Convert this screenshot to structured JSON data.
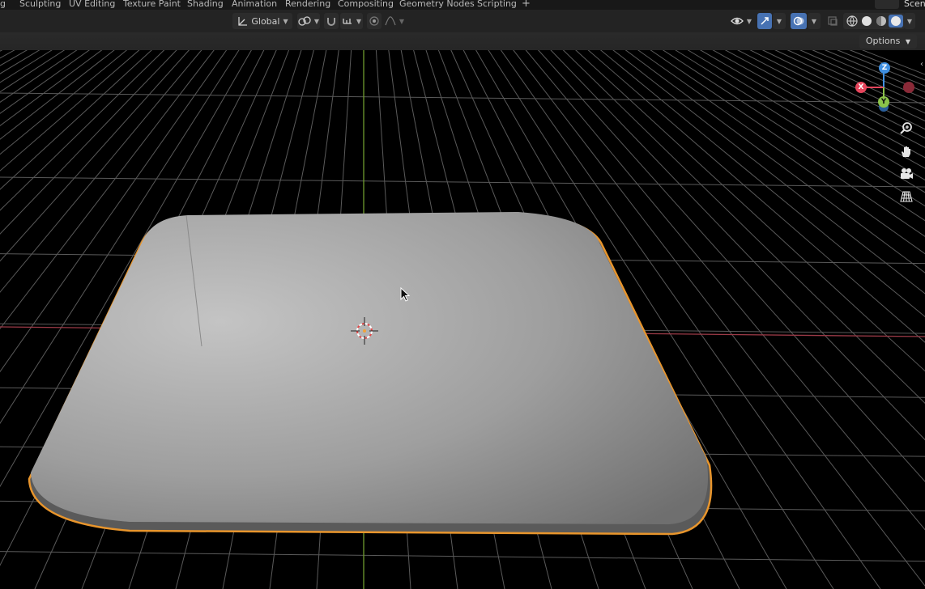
{
  "workspace_tabs": [
    {
      "label": "g"
    },
    {
      "label": "Sculpting"
    },
    {
      "label": "UV Editing"
    },
    {
      "label": "Texture Paint"
    },
    {
      "label": "Shading"
    },
    {
      "label": "Animation"
    },
    {
      "label": "Rendering"
    },
    {
      "label": "Compositing"
    },
    {
      "label": "Geometry Nodes"
    },
    {
      "label": "Scripting"
    }
  ],
  "add_workspace_label": "+",
  "scene_label": "Scen",
  "header": {
    "transform_orientation": "Global",
    "options_label": "Options"
  },
  "gizmo": {
    "x_label": "X",
    "y_label": "Y",
    "z_label": "Z",
    "x_color": "#e6455c",
    "y_color": "#8bc34a",
    "z_color": "#3f8fe0"
  },
  "viewport": {
    "background": "#3a3a3a",
    "grid_color": "#5a5a5a",
    "x_axis_color": "#9c3a47",
    "y_axis_color": "#6f9b2e",
    "selection_outline_color": "#f0a33a"
  },
  "icons": {
    "zoom": "zoom-icon",
    "pan": "hand-icon",
    "camera": "camera-icon",
    "perspective": "grid-perspective-icon"
  }
}
